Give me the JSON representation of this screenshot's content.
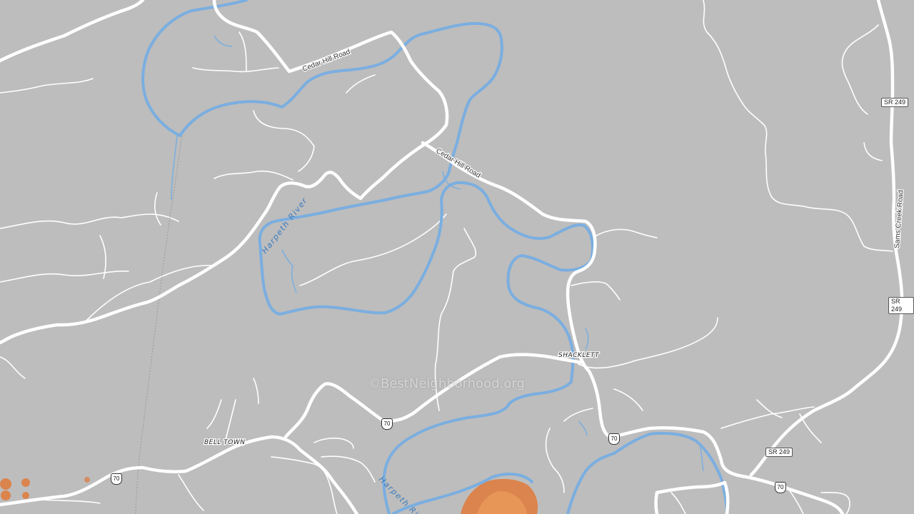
{
  "map": {
    "road_labels": {
      "cedar_hill_road_north": "Cedar Hill Road",
      "cedar_hill_road_south": "Cedar Hill Road",
      "sams_creek_road": "Sams Creek Road"
    },
    "river_labels": {
      "harpeth_north": "Harpeth River",
      "harpeth_south": "Harpeth River"
    },
    "place_labels": {
      "shacklett": "SHACKLETT",
      "bell_town": "BELL TOWN"
    },
    "shields": {
      "sr249_top": "SR 249",
      "sr249_mid": "SR 249",
      "sr249_bottom": "SR 249",
      "us70_center": "70",
      "us70_shacklett": "70",
      "us70_west": "70",
      "us70_east": "70"
    },
    "watermark": "©BestNeighborhood.org",
    "colors": {
      "background": "#bdbdbd",
      "road": "#ffffff",
      "water": "#7aaee0",
      "heat": "#e07a3a"
    }
  }
}
